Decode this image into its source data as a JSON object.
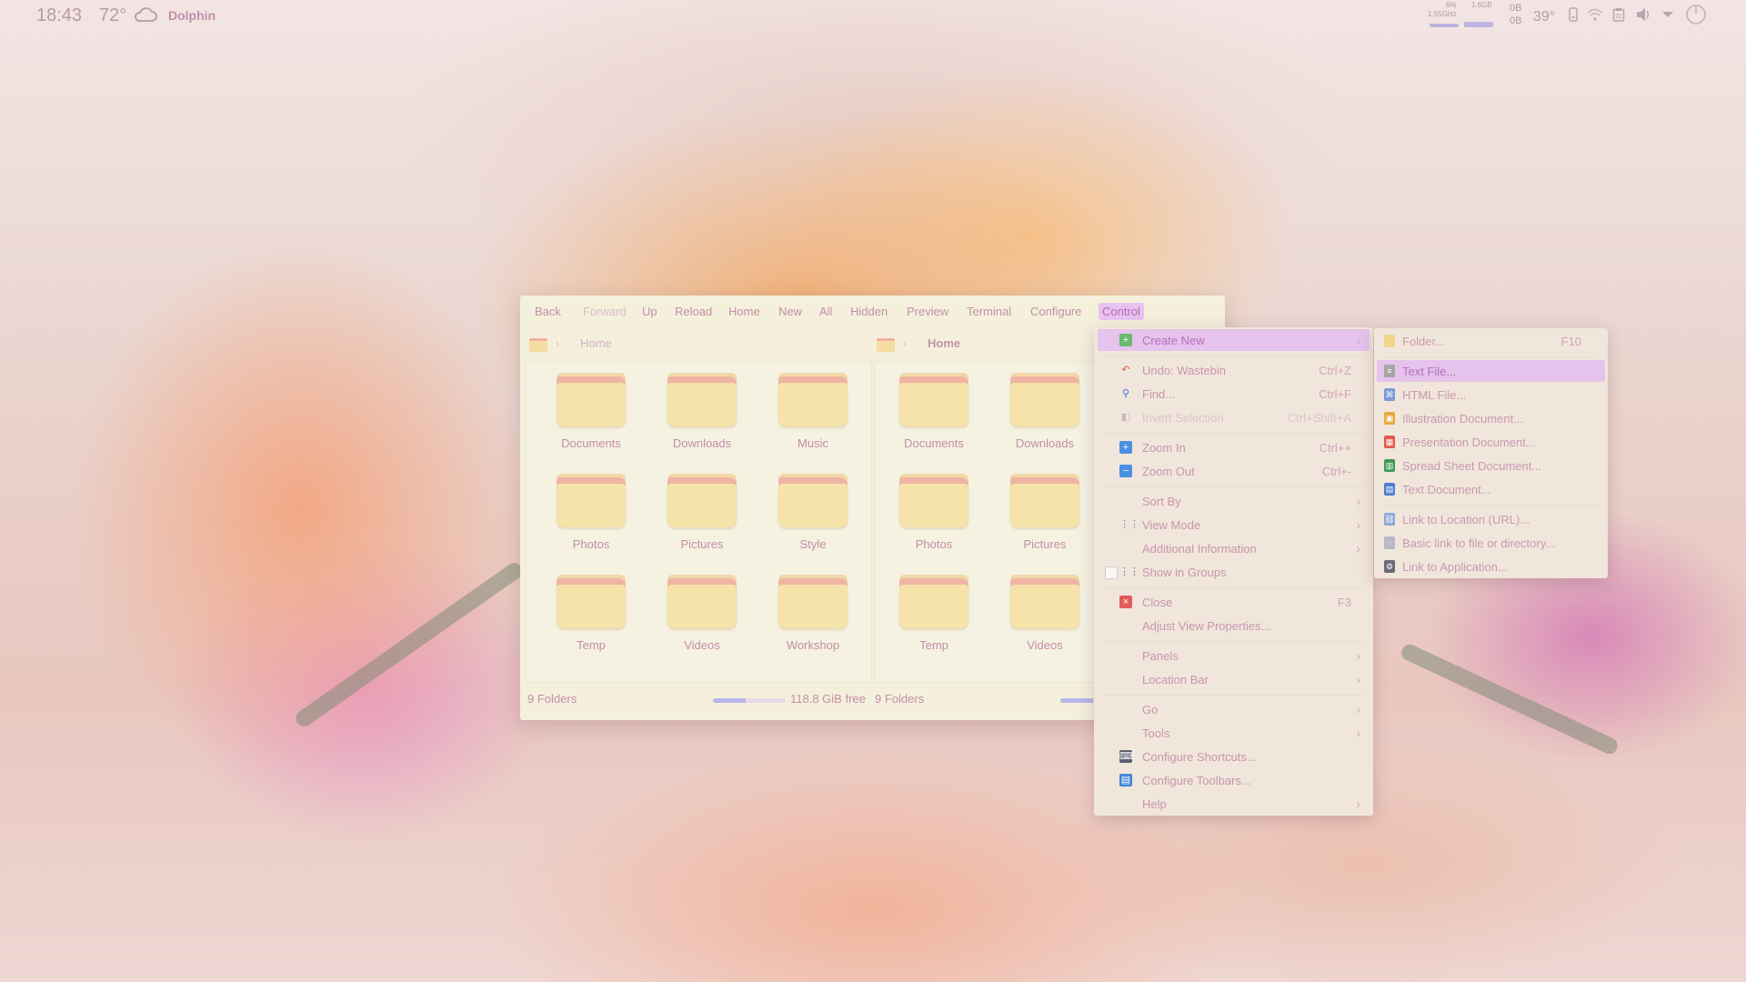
{
  "topbar": {
    "time": "18:43",
    "weather": "72°",
    "weather_icon": "cloud-icon",
    "active_app": "Dolphin",
    "cpu_percent": "6%",
    "cpu_freq": "1.55GHz",
    "mem_label": "1.6GB",
    "net_up": "0B",
    "net_down": "0B",
    "temperature": "39°",
    "tray_icons": [
      "phone-icon",
      "wifi-icon",
      "clipboard-icon",
      "volume-icon",
      "chevron-down-icon",
      "power-icon"
    ]
  },
  "window": {
    "toolbar": [
      {
        "label": "Back",
        "state": "normal"
      },
      {
        "label": "Forward",
        "state": "disabled"
      },
      {
        "label": "Up",
        "state": "normal"
      },
      {
        "label": "Reload",
        "state": "normal"
      },
      {
        "label": "Home",
        "state": "normal"
      },
      {
        "label": "New",
        "state": "normal"
      },
      {
        "label": "All",
        "state": "normal"
      },
      {
        "label": "Hidden",
        "state": "normal"
      },
      {
        "label": "Preview",
        "state": "normal"
      },
      {
        "label": "Terminal",
        "state": "normal"
      },
      {
        "label": "Configure",
        "state": "normal"
      },
      {
        "label": "Control",
        "state": "active"
      }
    ],
    "left_pane": {
      "breadcrumb": "Home",
      "folders": [
        "Documents",
        "Downloads",
        "Music",
        "Photos",
        "Pictures",
        "Style",
        "Temp",
        "Videos",
        "Workshop"
      ],
      "status": "9 Folders",
      "free_space": "118.8 GiB free",
      "used_fraction": 0.45
    },
    "right_pane": {
      "breadcrumb": "Home",
      "folders": [
        "Documents",
        "Downloads",
        "Photos",
        "Pictures",
        "Temp",
        "Videos"
      ],
      "status": "9 Folders"
    }
  },
  "control_menu": [
    {
      "label": "Create New",
      "icon": "create-new-icon",
      "submenu": true,
      "highlight": true
    },
    {
      "sep": true
    },
    {
      "label": "Undo: Wastebin",
      "icon": "undo-icon",
      "shortcut": "Ctrl+Z"
    },
    {
      "label": "Find...",
      "icon": "find-icon",
      "shortcut": "Ctrl+F"
    },
    {
      "label": "Invert Selection",
      "icon": "invert-selection-icon",
      "shortcut": "Ctrl+Shift+A",
      "disabled": true
    },
    {
      "sep": true
    },
    {
      "label": "Zoom In",
      "icon": "zoom-in-icon",
      "shortcut": "Ctrl++"
    },
    {
      "label": "Zoom Out",
      "icon": "zoom-out-icon",
      "shortcut": "Ctrl+-"
    },
    {
      "sep": true
    },
    {
      "label": "Sort By",
      "submenu": true
    },
    {
      "label": "View Mode",
      "icon": "view-mode-icon",
      "submenu": true
    },
    {
      "label": "Additional Information",
      "submenu": true
    },
    {
      "label": "Show in Groups",
      "icon": "show-groups-icon",
      "checkbox": true
    },
    {
      "sep": true
    },
    {
      "label": "Close",
      "icon": "close-icon",
      "shortcut": "F3"
    },
    {
      "label": "Adjust View Properties..."
    },
    {
      "sep": true
    },
    {
      "label": "Panels",
      "submenu": true
    },
    {
      "label": "Location Bar",
      "submenu": true
    },
    {
      "sep": true
    },
    {
      "label": "Go",
      "submenu": true
    },
    {
      "label": "Tools",
      "submenu": true
    },
    {
      "label": "Configure Shortcuts...",
      "icon": "keyboard-icon"
    },
    {
      "label": "Configure Toolbars...",
      "icon": "toolbar-icon"
    },
    {
      "label": "Help",
      "submenu": true
    }
  ],
  "create_new_menu": [
    {
      "label": "Folder...",
      "icon": "folder-icon",
      "shortcut": "F10",
      "color": "#f2d58a"
    },
    {
      "sep": true
    },
    {
      "label": "Text File...",
      "icon": "text-file-icon",
      "highlight": true,
      "color": "#a5a5a5"
    },
    {
      "label": "HTML File...",
      "icon": "html-file-icon",
      "color": "#7c9ad6"
    },
    {
      "label": "Illustration Document...",
      "icon": "illustration-doc-icon",
      "color": "#e7a83a"
    },
    {
      "label": "Presentation Document...",
      "icon": "presentation-doc-icon",
      "color": "#e15b4a"
    },
    {
      "label": "Spread Sheet Document...",
      "icon": "spreadsheet-doc-icon",
      "color": "#3e9a55"
    },
    {
      "label": "Text Document...",
      "icon": "text-doc-icon",
      "color": "#4b7fd1"
    },
    {
      "sep": true
    },
    {
      "label": "Link to Location (URL)...",
      "icon": "link-url-icon",
      "color": "#8ba7d8"
    },
    {
      "label": "Basic link to file or directory...",
      "icon": "basic-link-icon",
      "color": "#b7b7c7"
    },
    {
      "label": "Link to Application...",
      "icon": "link-app-icon",
      "color": "#6a6a78"
    }
  ]
}
